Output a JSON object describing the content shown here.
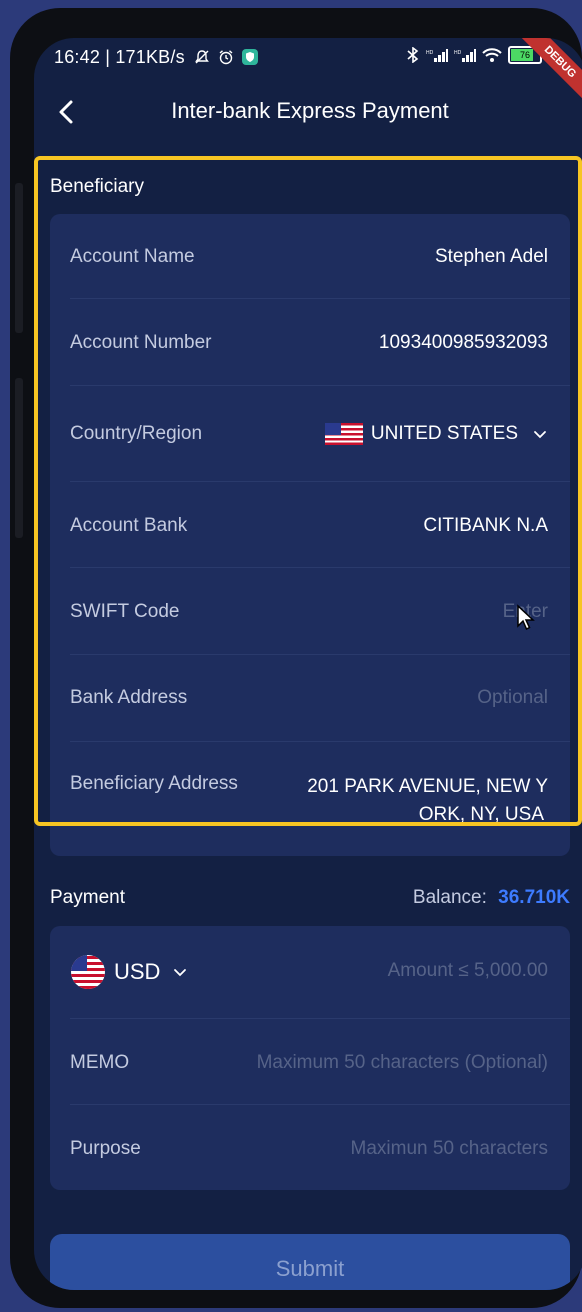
{
  "status_bar": {
    "time_speed": "16:42 | 171KB/s",
    "battery_level": "76",
    "debug_label": "DEBUG"
  },
  "app_bar": {
    "title": "Inter-bank Express Payment",
    "back_icon": "chevron-left-icon"
  },
  "beneficiary": {
    "section_title": "Beneficiary",
    "account_name": {
      "label": "Account Name",
      "value": "Stephen Adel"
    },
    "account_number": {
      "label": "Account Number",
      "value": "1093400985932093"
    },
    "country_region": {
      "label": "Country/Region",
      "value": "UNITED STATES",
      "flag": "us-flag-icon"
    },
    "account_bank": {
      "label": "Account Bank",
      "value": "CITIBANK N.A"
    },
    "swift_code": {
      "label": "SWIFT Code",
      "placeholder": "Enter"
    },
    "bank_address": {
      "label": "Bank Address",
      "placeholder": "Optional"
    },
    "beneficiary_address": {
      "label": "Beneficiary Address",
      "value_line1": "201 PARK AVENUE, NEW Y",
      "value_line2": "ORK, NY, USA"
    }
  },
  "payment": {
    "section_title": "Payment",
    "balance_label": "Balance:",
    "balance_value": "36.710K",
    "currency": "USD",
    "amount_placeholder": "Amount ≤ 5,000.00",
    "memo": {
      "label": "MEMO",
      "placeholder": "Maximum 50 characters (Optional)"
    },
    "purpose": {
      "label": "Purpose",
      "placeholder": "Maximun 50 characters"
    }
  },
  "submit_label": "Submit",
  "colors": {
    "background": "#132043",
    "card": "#1e2d5e",
    "accent_balance": "#3d7bff",
    "highlight": "#f7c523"
  }
}
